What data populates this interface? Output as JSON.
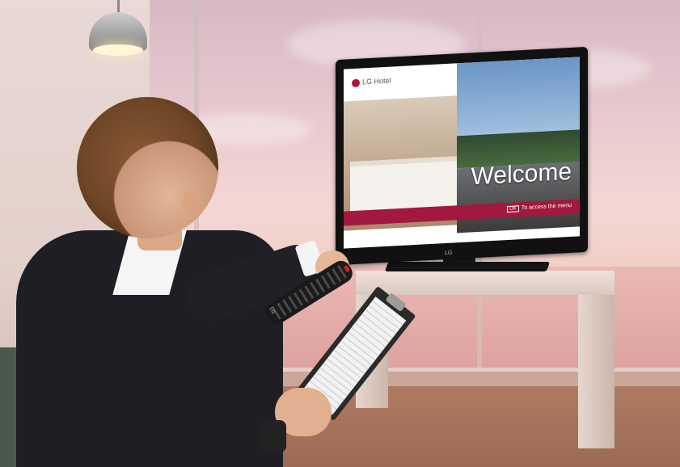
{
  "scene": {
    "description_label": "photo"
  },
  "tv": {
    "logo_text": "LG Hotel",
    "welcome_text": "Welcome",
    "menu_key": "OK",
    "menu_hint": "To access the menu",
    "bezel_brand": "LG"
  },
  "remote": {
    "brand": "LG"
  },
  "colors": {
    "accent_band": "#a3183e",
    "sky": "#e9c9cf"
  }
}
